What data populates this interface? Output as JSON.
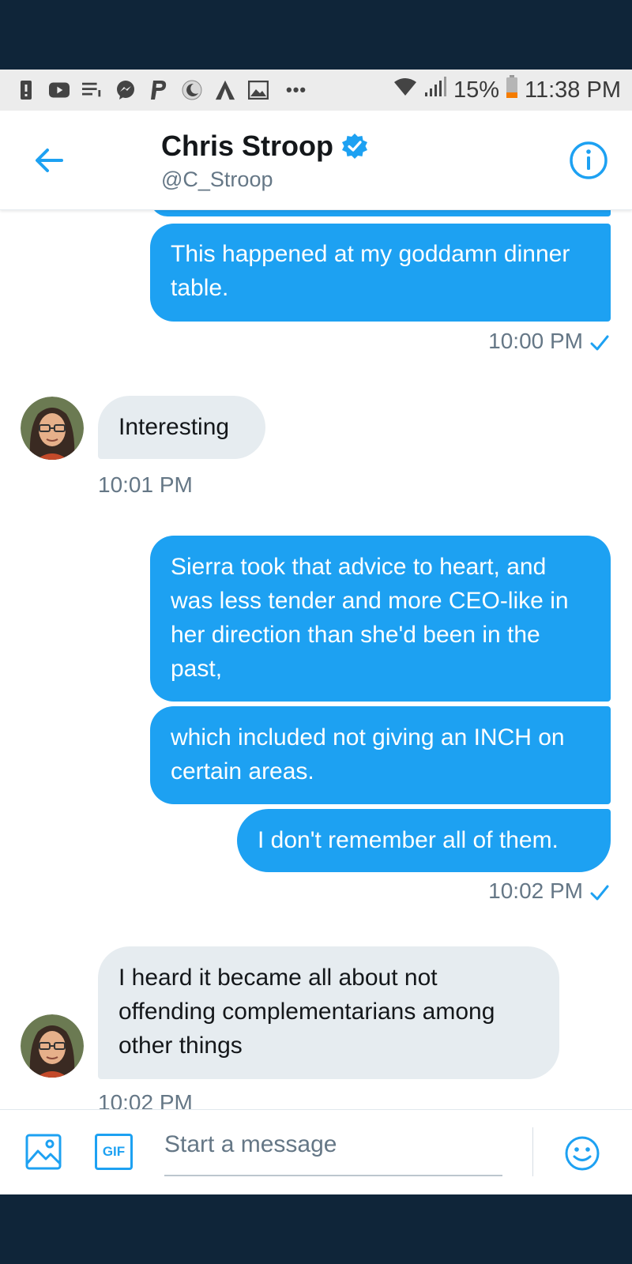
{
  "status_bar": {
    "battery": "15%",
    "time": "11:38 PM",
    "icons": [
      "alert-icon",
      "youtube-icon",
      "notes-icon",
      "messenger-icon",
      "paypal-icon",
      "moon-icon",
      "triangle-app-icon",
      "image-icon",
      "wifi-icon",
      "signal-icon",
      "battery-icon"
    ]
  },
  "header": {
    "name": "Chris Stroop",
    "handle": "@C_Stroop",
    "verified": true
  },
  "messages": [
    {
      "from": "me",
      "text": "This happened at my goddamn dinner table."
    },
    {
      "from": "me",
      "time": "10:00 PM",
      "read": true
    },
    {
      "from": "them",
      "text": "Interesting",
      "time": "10:01 PM"
    },
    {
      "from": "me",
      "text": "Sierra took that advice to heart, and was less tender and more CEO-like in her direction than she'd been in the past,"
    },
    {
      "from": "me",
      "text": "which included not giving an INCH on certain areas."
    },
    {
      "from": "me",
      "text": "I don't remember all of them.",
      "time": "10:02 PM",
      "read": true
    },
    {
      "from": "them",
      "text": "I heard it became all about not offending complementarians among other things",
      "time": "10:02 PM"
    }
  ],
  "composer": {
    "placeholder": "Start a message",
    "gif_label": "GIF"
  },
  "colors": {
    "accent": "#1da1f2",
    "bubble_in": "#e6ecf0",
    "frame": "#0f2539"
  }
}
